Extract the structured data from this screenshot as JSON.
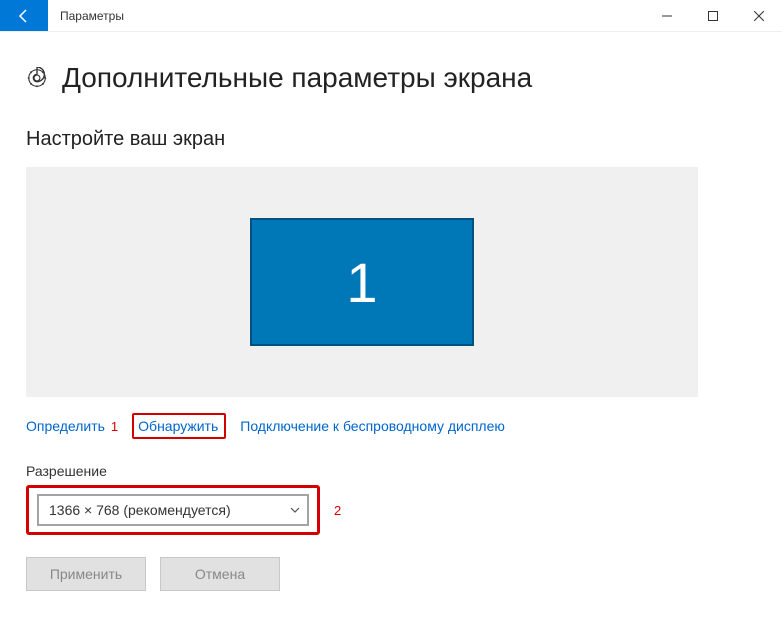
{
  "window": {
    "title": "Параметры"
  },
  "page": {
    "title": "Дополнительные параметры экрана",
    "section_title": "Настройте ваш экран"
  },
  "monitor": {
    "label": "1"
  },
  "links": {
    "identify": "Определить",
    "detect": "Обнаружить",
    "wireless": "Подключение к беспроводному дисплею"
  },
  "annotations": {
    "one": "1",
    "two": "2"
  },
  "resolution": {
    "label": "Разрешение",
    "selected": "1366 × 768 (рекомендуется)"
  },
  "buttons": {
    "apply": "Применить",
    "cancel": "Отмена"
  }
}
